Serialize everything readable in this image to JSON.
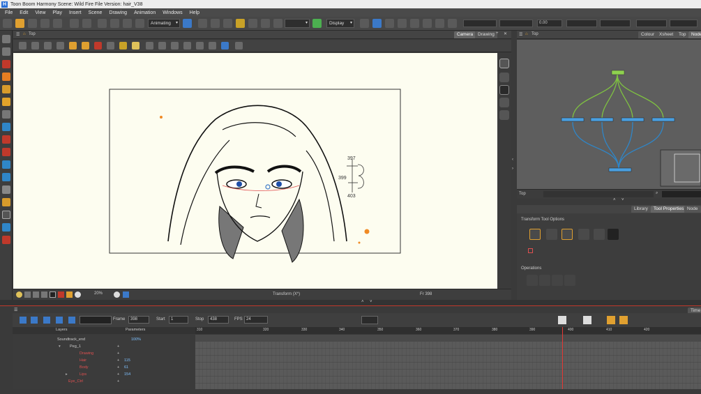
{
  "window": {
    "title": "Toon Boom Harmony Scene: Wild Fire File Version: hair_V38"
  },
  "menu": [
    "File",
    "Edit",
    "View",
    "Play",
    "Insert",
    "Scene",
    "Drawing",
    "Animation",
    "Windows",
    "Help"
  ],
  "toolbar": {
    "mode": "Animating",
    "display": "Display",
    "rotation": "0.00"
  },
  "camera_view": {
    "title": "Top",
    "tabs": [
      "Camera",
      "Drawing"
    ],
    "zoom": "20%",
    "status": "Transform (X*)",
    "frame_label": "Fr 398"
  },
  "sketch_notes": {
    "n1": "397",
    "n2": "399",
    "n3": "403"
  },
  "node_view": {
    "title": "Top",
    "tabs": [
      "Colour",
      "Xsheet",
      "Top",
      "Node"
    ],
    "search_label": "Top"
  },
  "tool_properties": {
    "tabs": [
      "Library",
      "Tool Properties",
      "Node Lib"
    ],
    "section": "Transform Tool Options",
    "operations": "Operations"
  },
  "timeline": {
    "frame_label": "Frame",
    "frame": "398",
    "start_label": "Start",
    "start": "1",
    "stop_label": "Stop",
    "stop": "438",
    "fps_label": "FPS",
    "fps": "24",
    "cols": {
      "layers": "Layers",
      "params": "Parameters"
    },
    "ruler": [
      "310",
      "320",
      "330",
      "340",
      "350",
      "360",
      "370",
      "380",
      "390",
      "400",
      "410",
      "420"
    ],
    "layers": [
      {
        "name": "Soundtrack_end",
        "param": "100%"
      },
      {
        "name": "Peg_1",
        "param": ""
      },
      {
        "name": "Drawing",
        "param": ""
      },
      {
        "name": "Hair",
        "param": "115"
      },
      {
        "name": "Body",
        "param": "61"
      },
      {
        "name": "Lips",
        "param": "154"
      },
      {
        "name": "Eye_Ctrl",
        "param": ""
      }
    ],
    "tab_right": "Time"
  },
  "colors": {
    "accent": "#3b79c8",
    "playhead": "#e53935",
    "canvas": "#fdfdf0",
    "node_green": "#7fc241",
    "node_blue": "#2f86c8"
  }
}
